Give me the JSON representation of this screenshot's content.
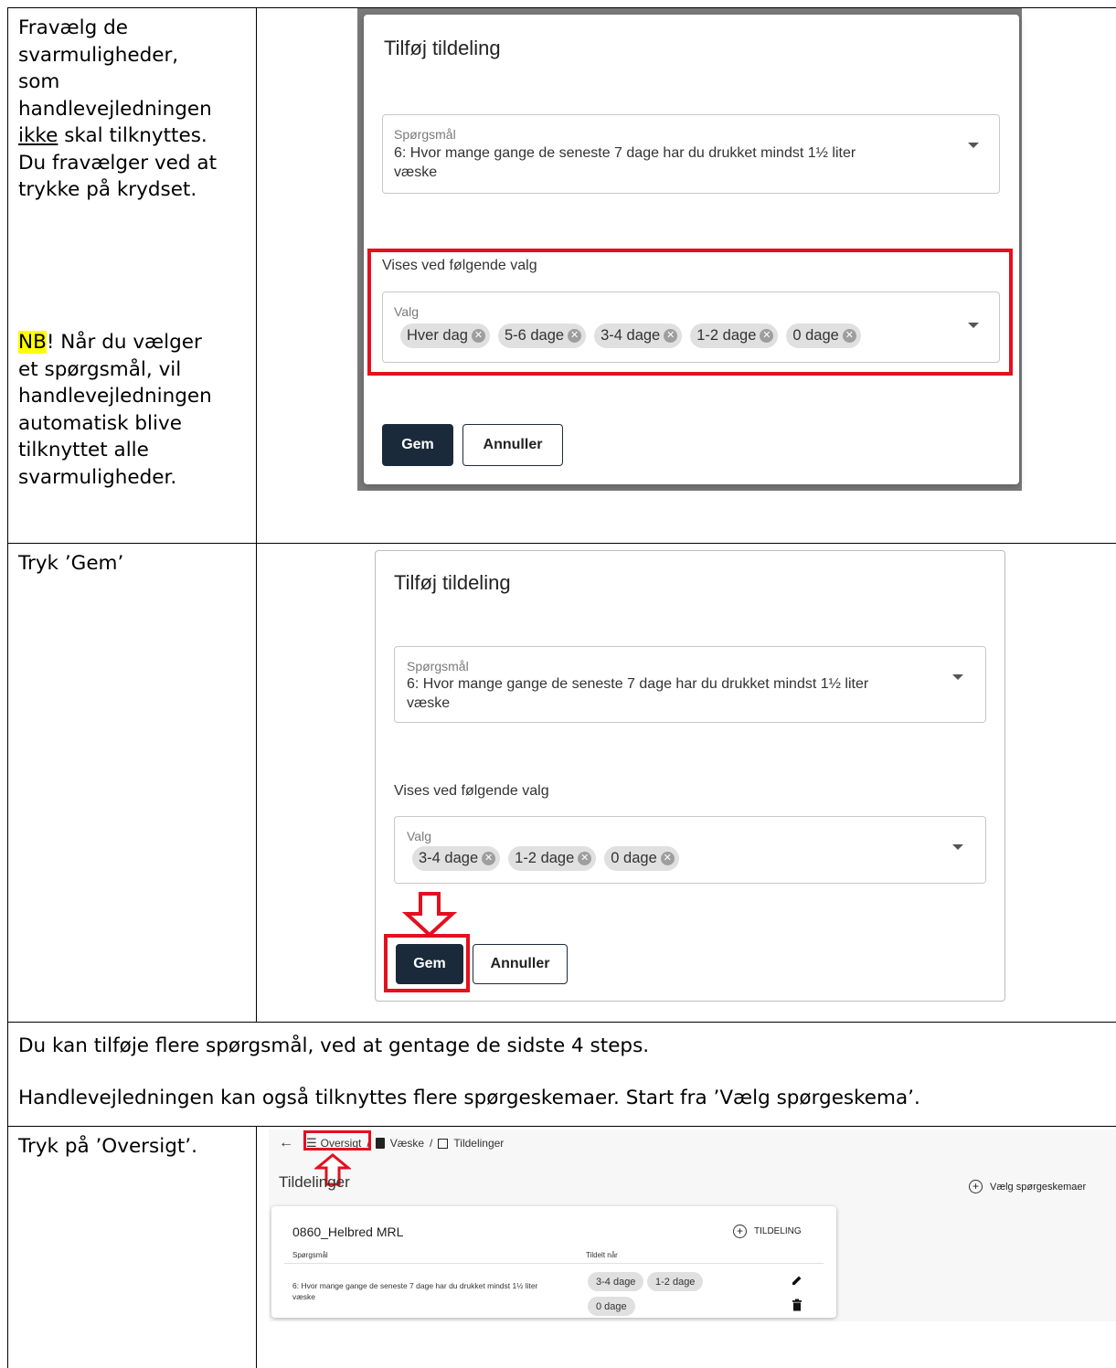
{
  "row1": {
    "instruction": [
      "Fravælg de",
      "svarmuligheder,",
      "som",
      "handlevejledningen",
      "ikke",
      "skal tilknyttes.",
      "Du fravælger ved at",
      "trykke på krydset."
    ],
    "note_highlight": "NB",
    "note_rest_1": "! Når du vælger",
    "note_lines": [
      "et spørgsmål, vil",
      "handlevejledningen",
      "automatisk blive",
      "tilknyttet alle",
      "svarmuligheder."
    ]
  },
  "dialog1": {
    "title": "Tilføj tildeling",
    "question_label": "Spørgsmål",
    "question_value_1": "6: Hvor mange gange de seneste 7 dage har du drukket mindst 1½ liter",
    "question_value_2": "væske",
    "section_label": "Vises ved følgende valg",
    "choice_label": "Valg",
    "chips": [
      "Hver dag",
      "5-6 dage",
      "3-4 dage",
      "1-2 dage",
      "0 dage"
    ],
    "save": "Gem",
    "cancel": "Annuller"
  },
  "row2": {
    "instruction": "Tryk ’Gem’"
  },
  "dialog2": {
    "title": "Tilføj tildeling",
    "question_label": "Spørgsmål",
    "question_value_1": "6: Hvor mange gange de seneste 7 dage har du drukket mindst 1½ liter",
    "question_value_2": "væske",
    "section_label": "Vises ved følgende valg",
    "choice_label": "Valg",
    "chips": [
      "3-4 dage",
      "1-2 dage",
      "0 dage"
    ],
    "save": "Gem",
    "cancel": "Annuller"
  },
  "row3": {
    "line1": "Du kan tilføje flere spørgsmål, ved at gentage de sidste 4 steps.",
    "line2": "Handlevejledningen kan også tilknyttes flere spørgeskemaer. Start fra ’Vælg spørgeskema’."
  },
  "row4": {
    "instruction": "Tryk på ’Oversigt’."
  },
  "overview": {
    "back": "←",
    "crumb_oversigt": "Oversigt",
    "crumb_sep": "/",
    "crumb_vaeske": "Væske",
    "crumb_tildelinger": "Tildelinger",
    "title": "Tildelinger",
    "select_questionnaires": "Vælg spørgeskemaer",
    "card_title": "0860_Helbred MRL",
    "add_assignment": "TILDELING",
    "col_question": "Spørgsmål",
    "col_assigned": "Tildelt når",
    "row_question_1": "6: Hvor mange gange de seneste 7 dage har du drukket mindst 1½ liter",
    "row_question_2": "væske",
    "row_chips": [
      "3-4 dage",
      "1-2 dage",
      "0 dage"
    ]
  }
}
